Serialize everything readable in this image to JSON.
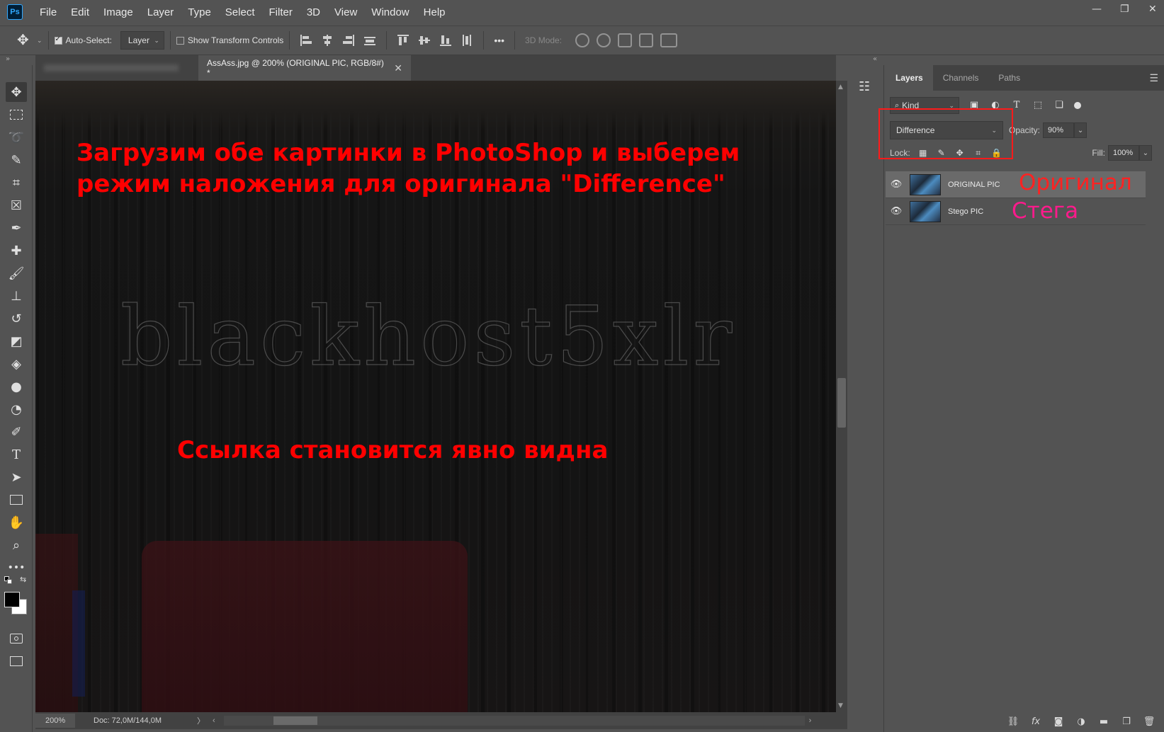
{
  "app": {
    "logo_text": "Ps"
  },
  "menu": [
    "File",
    "Edit",
    "Image",
    "Layer",
    "Type",
    "Select",
    "Filter",
    "3D",
    "View",
    "Window",
    "Help"
  ],
  "options": {
    "auto_select_label": "Auto-Select:",
    "auto_select_checked": true,
    "auto_select_target": "Layer",
    "show_transform_label": "Show Transform Controls",
    "show_transform_checked": false,
    "more_label": "•••",
    "threed_mode_label": "3D Mode:"
  },
  "tabs": [
    {
      "label": "",
      "active": false
    },
    {
      "label": "AssAss.jpg @ 200% (ORIGINAL PIC, RGB/8#) *",
      "active": true,
      "close": "✕"
    }
  ],
  "canvas": {
    "watermark": "blackhost5xlr",
    "annotation_1_line_1": "Загрузим обе картинки в PhotoShop и выберем",
    "annotation_1_line_2": "режим наложения для оригинала \"Difference\"",
    "annotation_2": "Ссылка становится явно видна"
  },
  "status": {
    "zoom": "200%",
    "doc_info": "Doc: 72,0M/144,0M",
    "arrow": "〉",
    "scroll_left": "‹",
    "scroll_right": "›"
  },
  "layers_panel": {
    "tabs": [
      "Layers",
      "Channels",
      "Paths"
    ],
    "active_tab": "Layers",
    "filter_kind": "Kind",
    "blend_mode": "Difference",
    "opacity_label": "Opacity:",
    "opacity_value": "90%",
    "lock_label": "Lock:",
    "fill_label": "Fill:",
    "fill_value": "100%",
    "layers": [
      {
        "name": "ORIGINAL PIC",
        "selected": true,
        "annotation": "Оригинал",
        "annotation_color": "#ff2222"
      },
      {
        "name": "Stego PIC",
        "selected": false,
        "annotation": "Стега",
        "annotation_color": "#ff1a8c"
      }
    ],
    "bottom_icons": [
      "link-layers-icon",
      "fx-icon",
      "add-mask-icon",
      "adjustment-layer-icon",
      "new-group-icon",
      "new-layer-icon",
      "delete-layer-icon"
    ],
    "fx_label": "fx"
  },
  "colors": {
    "accent_highlight": "#ff1a1a",
    "annotation_red": "#ff0000",
    "ps_blue": "#31a8ff"
  }
}
